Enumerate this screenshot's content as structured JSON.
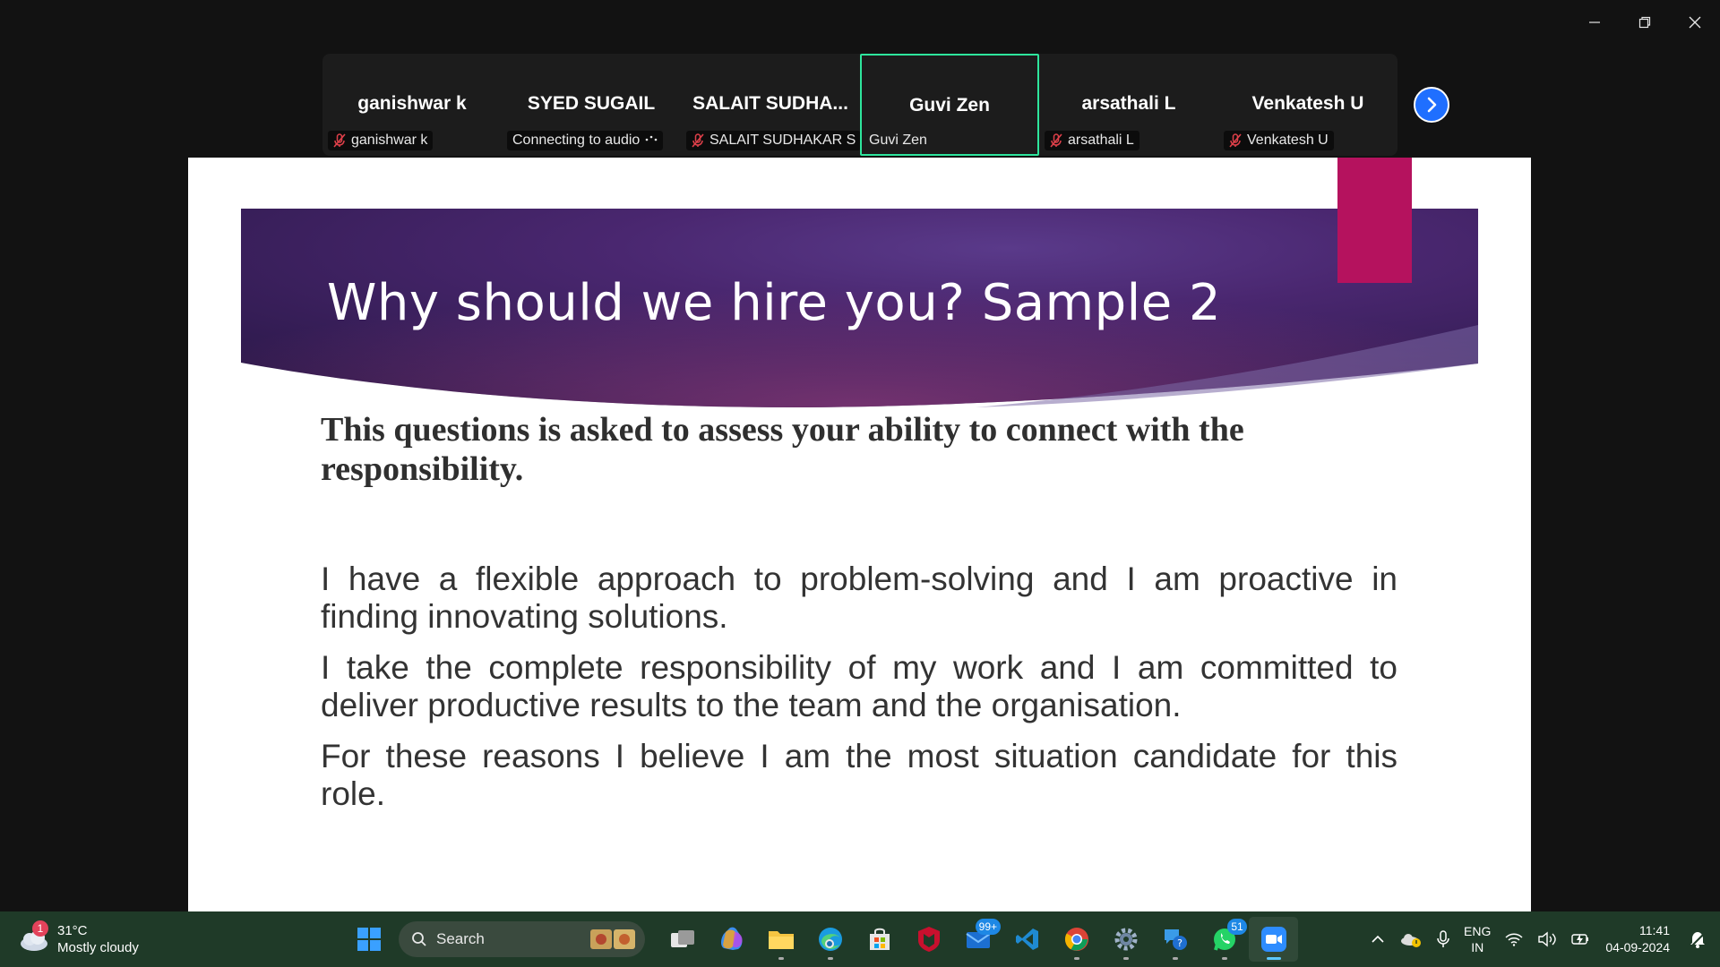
{
  "window": {
    "controls": [
      "minimize-icon",
      "restore-icon",
      "close-icon"
    ]
  },
  "gallery": {
    "tiles": [
      {
        "name": "ganishwar k",
        "label": "ganishwar k",
        "muted": true
      },
      {
        "name": "SYED SUGAIL",
        "label": "Connecting to audio",
        "muted": false,
        "connecting": true
      },
      {
        "name": "SALAIT  SUDHA...",
        "label": "SALAIT SUDHAKAR S",
        "muted": true
      },
      {
        "name": "Guvi Zen",
        "label": "Guvi Zen",
        "muted": false,
        "active": true
      },
      {
        "name": "arsathali L",
        "label": "arsathali L",
        "muted": true
      },
      {
        "name": "Venkatesh U",
        "label": "Venkatesh U",
        "muted": true
      }
    ],
    "colors": {
      "active_border": "#2ee59d",
      "next_button": "#1f6fff"
    }
  },
  "slide": {
    "title": "Why should we hire you? Sample 2",
    "lead": "This questions is asked to assess your ability to connect with the responsibility.",
    "bullets": [
      "I have a flexible approach to problem-solving and I am proactive in finding innovating solutions.",
      "I take the complete responsibility of my work and I am committed to deliver productive results to the team and the organisation.",
      "For these reasons I believe I am the most situation candidate for this role."
    ],
    "colors": {
      "banner_dark": "#2b1a4f",
      "banner_mid": "#6a2a6e",
      "accent": "#b5125e"
    }
  },
  "taskbar": {
    "weather": {
      "badge": "1",
      "temp": "31°C",
      "condition": "Mostly cloudy"
    },
    "search_placeholder": "Search",
    "apps": [
      {
        "icon": "windows-start-icon"
      },
      {
        "icon": "task-view-icon"
      },
      {
        "icon": "copilot-icon"
      },
      {
        "icon": "file-explorer-icon"
      },
      {
        "icon": "edge-icon"
      },
      {
        "icon": "store-icon"
      },
      {
        "icon": "mcafee-icon"
      },
      {
        "icon": "mail-icon",
        "badge": "99+"
      },
      {
        "icon": "vscode-icon"
      },
      {
        "icon": "chrome-icon"
      },
      {
        "icon": "settings-icon"
      },
      {
        "icon": "help-icon"
      },
      {
        "icon": "whatsapp-icon",
        "badge": "51"
      },
      {
        "icon": "zoom-icon",
        "active": true
      }
    ],
    "tray": {
      "lang_top": "ENG",
      "lang_bottom": "IN",
      "time": "11:41",
      "date": "04-09-2024"
    }
  }
}
